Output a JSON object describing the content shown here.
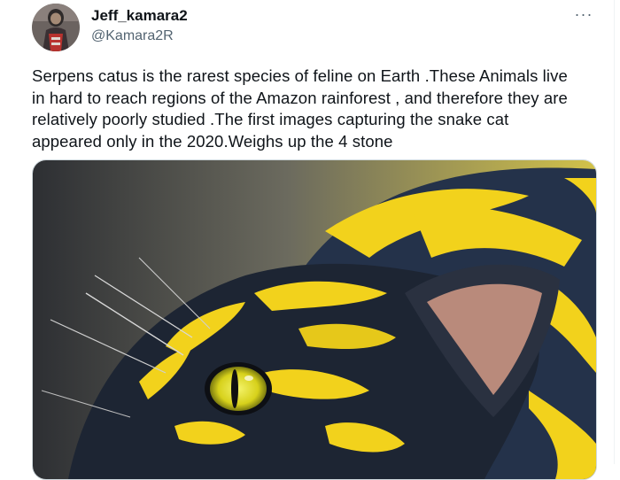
{
  "author": {
    "display_name": "Jeff_kamara2",
    "handle": "@Kamara2R",
    "avatar_icon": "avatar-figure-icon"
  },
  "more_menu": {
    "label": "···",
    "icon": "more-dots-icon"
  },
  "tweet": {
    "text_lines": [
      "Serpens catus is the rarest species of feline on Earth .These Animals live",
      "in hard to reach regions of the Amazon rainforest , and therefore they are",
      "relatively poorly studied .The first images capturing the snake cat",
      "appeared only in the 2020.Weighs up the 4 stone"
    ]
  },
  "colors": {
    "text": "#0f1419",
    "secondary_text": "#536471",
    "border": "#cfd9de",
    "image_yellow": "#f2d21c",
    "image_dark": "#1f2a3c"
  }
}
